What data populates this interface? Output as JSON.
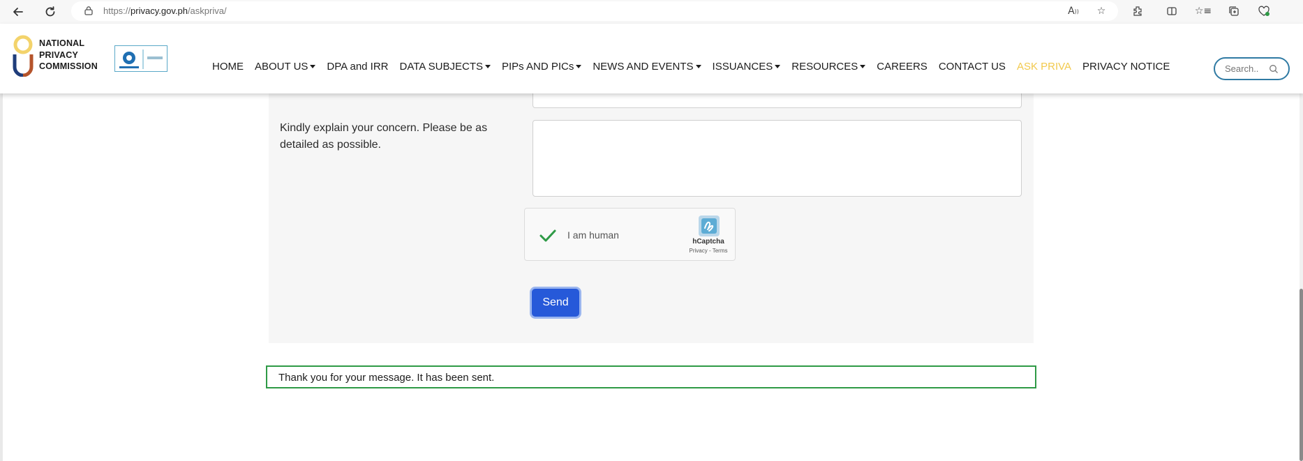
{
  "browser": {
    "url_prefix": "https://",
    "url_host": "privacy.gov.ph",
    "url_path": "/askpriva/",
    "back_icon": "arrow-left",
    "reload_icon": "reload",
    "toolbar_icons": [
      "read-aloud-icon",
      "favorite-star-icon",
      "extensions-icon",
      "split-screen-icon",
      "favorites-icon",
      "collections-icon",
      "browser-essentials-icon"
    ]
  },
  "header": {
    "logo_lines": [
      "NATIONAL",
      "PRIVACY",
      "COMMISSION"
    ],
    "cert_badge": "socotec",
    "nav": [
      {
        "label": "HOME",
        "dropdown": false,
        "active": false
      },
      {
        "label": "ABOUT US",
        "dropdown": true,
        "active": false
      },
      {
        "label": "DPA and IRR",
        "dropdown": false,
        "active": false
      },
      {
        "label": "DATA SUBJECTS",
        "dropdown": true,
        "active": false
      },
      {
        "label": "PIPs AND PICs",
        "dropdown": true,
        "active": false
      },
      {
        "label": "NEWS AND EVENTS",
        "dropdown": true,
        "active": false
      },
      {
        "label": "ISSUANCES",
        "dropdown": true,
        "active": false
      },
      {
        "label": "RESOURCES",
        "dropdown": true,
        "active": false
      },
      {
        "label": "CAREERS",
        "dropdown": false,
        "active": false
      },
      {
        "label": "CONTACT US",
        "dropdown": false,
        "active": false
      },
      {
        "label": "ASK PRIVA",
        "dropdown": false,
        "active": true
      },
      {
        "label": "PRIVACY NOTICE",
        "dropdown": false,
        "active": false
      }
    ],
    "search_placeholder": "Search..",
    "active_color": "#f2c94c"
  },
  "form": {
    "concern_label": "Kindly explain your concern. Please be as detailed as possible.",
    "concern_value": "",
    "captcha": {
      "checkbox_label": "I am human",
      "brand": "hCaptcha",
      "links": "Privacy - Terms",
      "checked": true
    },
    "send_label": "Send",
    "send_color": "#2659d9"
  },
  "alert": {
    "message": "Thank you for your message. It has been sent.",
    "border_color": "#2e9a46"
  }
}
